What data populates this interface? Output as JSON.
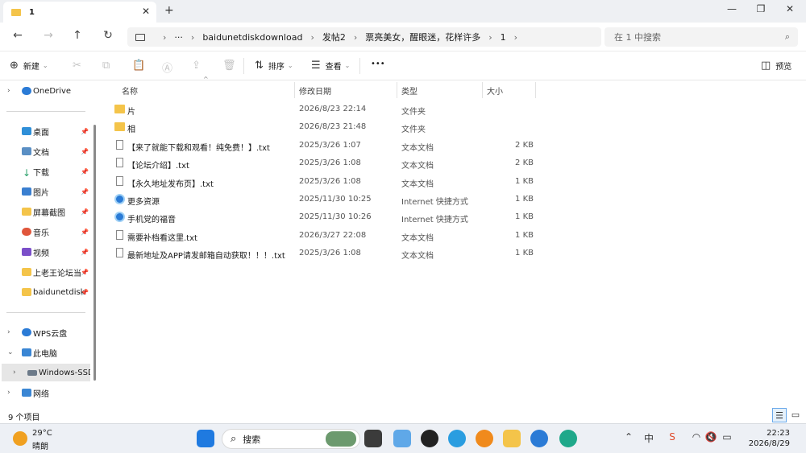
{
  "window": {
    "tab_label": "1",
    "close_glyph": "✕",
    "new_tab_glyph": "+",
    "minimize_glyph": "—",
    "maximize_glyph": "❐",
    "close_window_glyph": "✕"
  },
  "nav": {
    "back": "←",
    "forward": "→",
    "up": "↑",
    "refresh": "↻",
    "ellipsis": "···",
    "breadcrumb": [
      "baidunetdiskdownload",
      "发帖2",
      "票亮美女，醒眼迷，花样许多",
      "1"
    ],
    "search_placeholder": "在 1 中搜索"
  },
  "toolbar": {
    "new_label": "新建",
    "sort_label": "排序",
    "view_label": "查看",
    "more_label": "•••",
    "preview_label": "预览"
  },
  "sidebar": {
    "onedrive": "OneDrive",
    "quick": [
      {
        "label": "桌面",
        "color": "#2f8fd8"
      },
      {
        "label": "文档",
        "color": "#5a8fc4"
      },
      {
        "label": "下载",
        "color": "#2aa06a"
      },
      {
        "label": "图片",
        "color": "#3a7fd0"
      },
      {
        "label": "屏幕截图",
        "color": "#f4c44a"
      },
      {
        "label": "音乐",
        "color": "#e0563b"
      },
      {
        "label": "视频",
        "color": "#7b4fc9"
      },
      {
        "label": "上老王论坛当",
        "color": "#f4c44a"
      },
      {
        "label": "baidunetdisk",
        "color": "#f4c44a"
      }
    ],
    "wps": "WPS云盘",
    "thispc": "此电脑",
    "windows_ssd": "Windows-SSD",
    "network": "网络"
  },
  "columns": {
    "name": "名称",
    "date": "修改日期",
    "type": "类型",
    "size": "大小"
  },
  "files": [
    {
      "icon": "folder",
      "name": "片",
      "date": "2026/8/23 22:14",
      "type": "文件夹",
      "size": ""
    },
    {
      "icon": "folder",
      "name": "相",
      "date": "2026/8/23 21:48",
      "type": "文件夹",
      "size": ""
    },
    {
      "icon": "txt",
      "name": "【来了就能下载和观看！纯免费！】.txt",
      "date": "2025/3/26 1:07",
      "type": "文本文档",
      "size": "2 KB"
    },
    {
      "icon": "txt",
      "name": "【论坛介绍】.txt",
      "date": "2025/3/26 1:08",
      "type": "文本文档",
      "size": "2 KB"
    },
    {
      "icon": "txt",
      "name": "【永久地址发布页】.txt",
      "date": "2025/3/26 1:08",
      "type": "文本文档",
      "size": "1 KB"
    },
    {
      "icon": "link",
      "name": "更多资源",
      "date": "2025/11/30 10:25",
      "type": "Internet 快捷方式",
      "size": "1 KB"
    },
    {
      "icon": "link",
      "name": "手机党的福音",
      "date": "2025/11/30 10:26",
      "type": "Internet 快捷方式",
      "size": "1 KB"
    },
    {
      "icon": "txt",
      "name": "需要补档看这里.txt",
      "date": "2026/3/27 22:08",
      "type": "文本文档",
      "size": "1 KB"
    },
    {
      "icon": "txt",
      "name": "最新地址及APP请发邮箱自动获取！！！.txt",
      "date": "2025/3/26 1:08",
      "type": "文本文档",
      "size": "1 KB"
    }
  ],
  "status": {
    "count": "9 个项目"
  },
  "taskbar": {
    "temp": "29°C",
    "weather": "晴朗",
    "search_label": "搜索",
    "time": "22:23",
    "date": "2026/8/29",
    "ime": "中"
  }
}
